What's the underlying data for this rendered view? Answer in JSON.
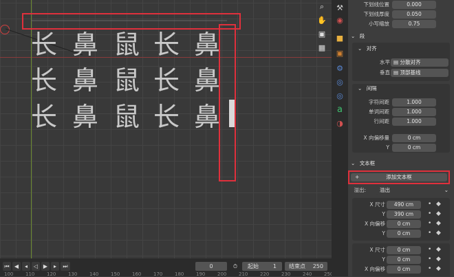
{
  "viewport": {
    "glyph_rows": [
      [
        "长",
        "鼻",
        "鼠",
        "长",
        "鼻"
      ],
      [
        "长",
        "鼻",
        "鼠",
        "长",
        "鼻"
      ],
      [
        "长",
        "鼻",
        "鼠",
        "长",
        "鼻"
      ]
    ]
  },
  "timeline": {
    "current_frame": "0",
    "start_label": "起始",
    "start_value": "1",
    "end_label": "结束点",
    "end_value": "250",
    "ruler": [
      "100",
      "110",
      "120",
      "130",
      "140",
      "150",
      "160",
      "170",
      "180",
      "190",
      "200",
      "210",
      "220",
      "230",
      "240",
      "250"
    ]
  },
  "properties": {
    "top_fields": [
      {
        "label": "下划线位置",
        "value": "0.000"
      },
      {
        "label": "下划线厚度",
        "value": "0.050"
      },
      {
        "label": "小写缩放",
        "value": "0.75"
      }
    ],
    "paragraph": {
      "title": "段",
      "align_title": "对齐",
      "horizontal_label": "水平",
      "horizontal_value": "分散对齐",
      "vertical_label": "垂直",
      "vertical_value": "顶部基线",
      "spacing_title": "间隔",
      "spacing_fields": [
        {
          "label": "字符间距",
          "value": "1.000"
        },
        {
          "label": "单词间距",
          "value": "1.000"
        },
        {
          "label": "行间距",
          "value": "1.000"
        }
      ],
      "offset_fields": [
        {
          "label": "X 向偏移量",
          "value": "0 cm"
        },
        {
          "label": "Y",
          "value": "0 cm"
        }
      ]
    },
    "textbox": {
      "title": "文本框",
      "add_button": "添加文本框",
      "overflow_label": "溢出:",
      "overflow_value": "溢出",
      "boxes": [
        {
          "size_x_label": "X 尺寸",
          "size_x": "490 cm",
          "size_y_label": "Y",
          "size_y": "390 cm",
          "off_x_label": "X 向偏移",
          "off_x": "0 cm",
          "off_y_label": "Y",
          "off_y": "0 cm"
        },
        {
          "size_x_label": "X 尺寸",
          "size_x": "0 cm",
          "size_y_label": "Y",
          "size_y": "0 cm",
          "off_x_label": "X 向偏移",
          "off_x": "0 cm"
        }
      ]
    }
  }
}
